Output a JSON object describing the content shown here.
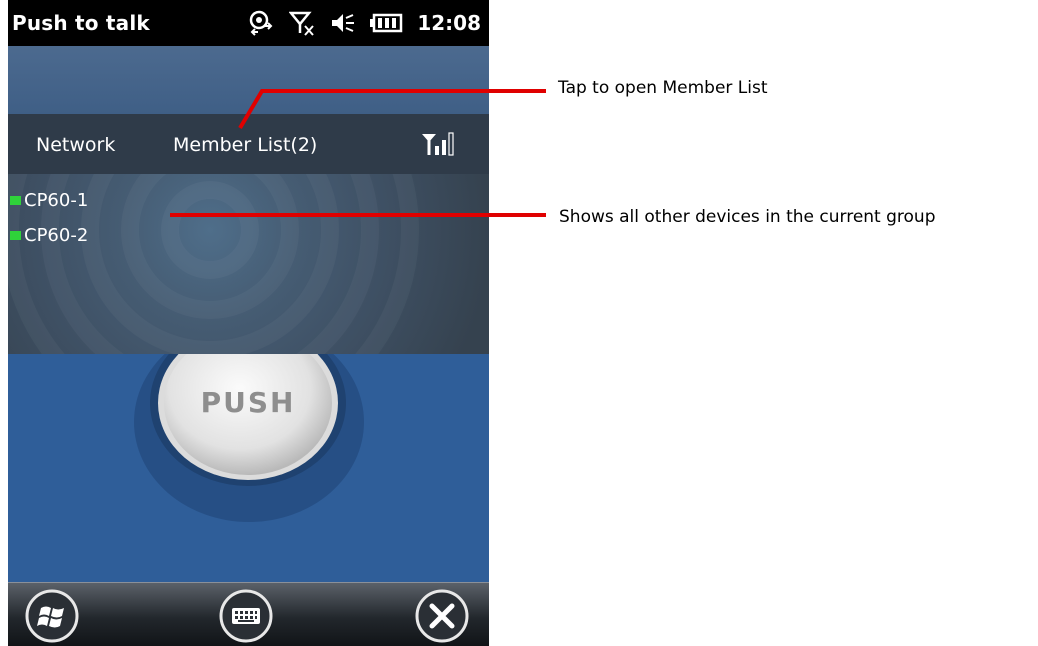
{
  "status_bar": {
    "title": "Push to talk",
    "time": "12:08",
    "icons": [
      "connectivity-icon",
      "no-signal-icon",
      "speaker-muted-icon",
      "battery-icon"
    ]
  },
  "nav": {
    "network_label": "Network",
    "member_list_label": "Member List(2)",
    "signal_icon": "signal-strength-icon"
  },
  "members": [
    {
      "name": "CP60-1",
      "status_color": "#2fd23a"
    },
    {
      "name": "CP60-2",
      "status_color": "#2fd23a"
    }
  ],
  "push_button": {
    "label": "PUSH"
  },
  "taskbar": {
    "icons": [
      "windows-start-icon",
      "keyboard-icon",
      "close-icon"
    ]
  },
  "annotations": {
    "member_list_callout": "Tap to open Member List",
    "members_callout": "Shows all other devices in the current group"
  },
  "colors": {
    "accent_blue": "#2f5e99",
    "nav_bar": "#2f3b49",
    "callout_line": "#e00000",
    "member_online": "#2fd23a"
  }
}
